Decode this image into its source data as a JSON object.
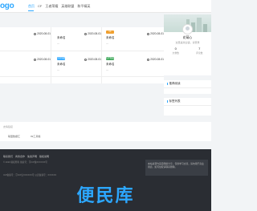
{
  "header": {
    "logo": "ogo",
    "nav": [
      "首页",
      "CF",
      "王者荣耀",
      "英雄联盟",
      "和平精英"
    ],
    "active_index": 0
  },
  "cards": [
    {
      "date": "2020-08-01",
      "title": "",
      "badge": "",
      "badge_color": ""
    },
    {
      "date": "2020-08-01",
      "title": "未命名",
      "badge": "",
      "badge_color": ""
    },
    {
      "date": "2020-08-01",
      "title": "未命名",
      "badge": "",
      "badge_color": ""
    },
    {
      "date": "2020-08-01",
      "title": "",
      "badge": "",
      "badge_color": ""
    },
    {
      "date": "2020-08-01",
      "title": "未命名",
      "badge": "王者荣耀",
      "badge_color": "#2ca7ff"
    },
    {
      "date": "2020-08-01",
      "title": "未命名",
      "badge": "和平精英",
      "badge_color": "#3aa757"
    }
  ],
  "cards_extra_badge": {
    "text": "CF",
    "color": "#f0a030"
  },
  "card_dash": "—",
  "profile": {
    "name": "花萌心",
    "subtitle": "这里是欢迎语，请登录",
    "stats": [
      {
        "num": "0",
        "label": "文章数"
      },
      {
        "num": "7",
        "label": "评论数"
      }
    ]
  },
  "sidebar": {
    "box1": "推荐阅读",
    "box2": "标签列表"
  },
  "links": {
    "header": "友情链接",
    "items": [
      "联盟数据汇",
      "99工具箱"
    ]
  },
  "footer": {
    "links": [
      "联系我们",
      "商务合作",
      "免责声明",
      "版权说明"
    ],
    "text": "© 2020 版权所有  备案号：京ICP备XXXXXX号",
    "line2": "ICP备案号：京ICP证XXXXXX号  公安备案号：XXXXXX",
    "notice": "本站资源均来自网络分享，仅供学习交流，请勿用于商业用途。如有侵权请联系删除。",
    "watermark": "便民库"
  },
  "colors": {
    "accent": "#2ca7ff"
  }
}
